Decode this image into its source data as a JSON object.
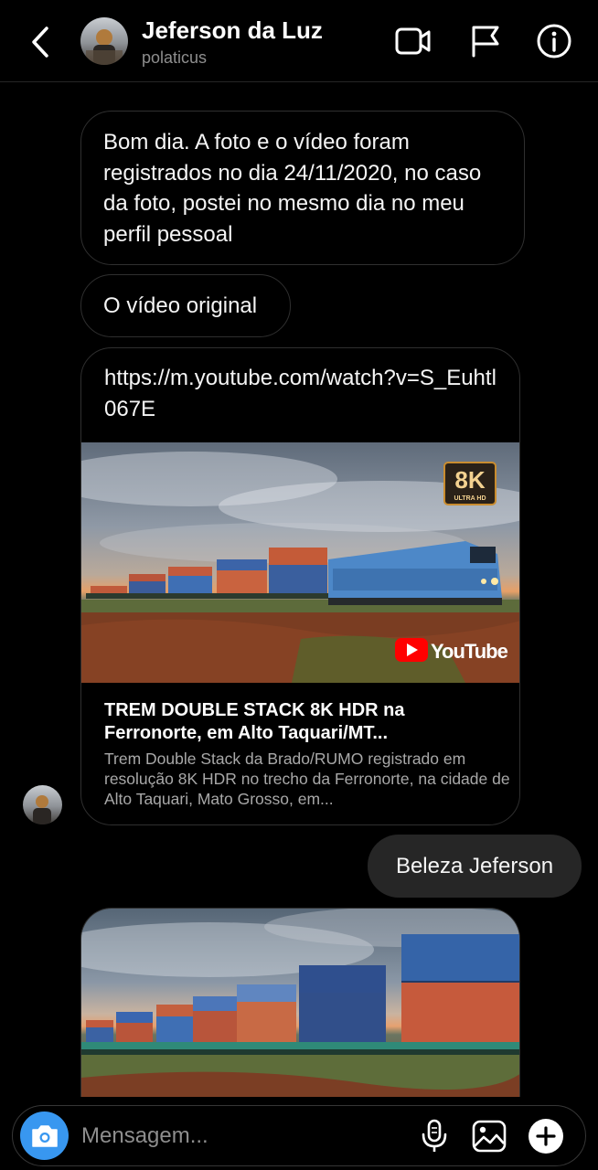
{
  "header": {
    "name": "Jeferson da Luz",
    "username": "polaticus"
  },
  "messages": {
    "msg1": "Bom dia. A foto e o vídeo foram registrados no dia 24/11/2020, no caso da foto, postei no mesmo dia no meu perfil pessoal",
    "msg2": "O vídeo original",
    "link": {
      "url": "https://m.youtube.com/watch?v=S_Euhtl067E",
      "badge_main": "8K",
      "badge_sub": "ULTRA HD",
      "youtube_label": "YouTube",
      "title": "TREM DOUBLE STACK 8K HDR na Ferronorte, em Alto Taquari/MT...",
      "description": "Trem Double Stack da Brado/RUMO registrado em resolução 8K HDR no trecho da Ferronorte, na cidade de Alto Taquari, Mato Grosso, em..."
    },
    "outgoing": "Beleza Jeferson"
  },
  "composer": {
    "placeholder": "Mensagem..."
  },
  "icons": {
    "back": "chevron-left-icon",
    "video": "video-camera-icon",
    "report": "flag-icon",
    "info": "info-icon",
    "camera": "camera-icon",
    "mic": "microphone-icon",
    "gallery": "image-icon",
    "add": "plus-icon"
  },
  "colors": {
    "background": "#000000",
    "bubble_border": "#2f2f2f",
    "outgoing_bubble": "#262626",
    "camera_button": "#3897f0",
    "muted_text": "#8e8e8e"
  }
}
